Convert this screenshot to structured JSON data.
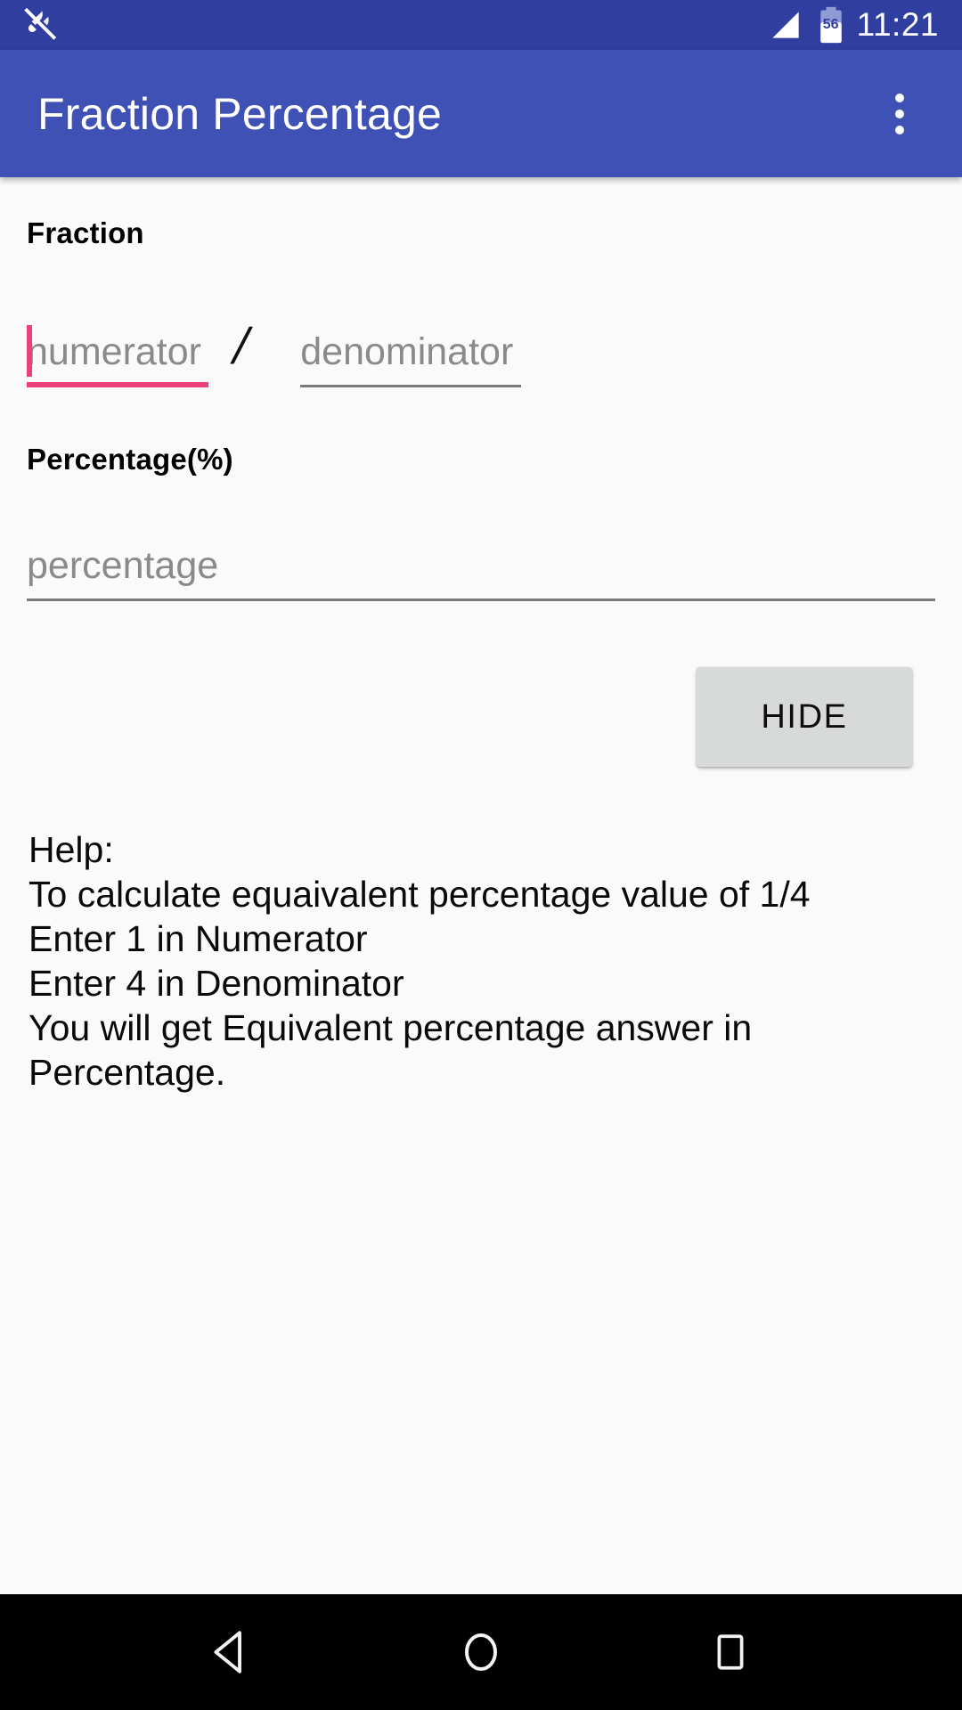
{
  "status_bar": {
    "notification_icon": "do-not-disturb-slash-icon",
    "signal_icon": "signal-triangle-icon",
    "battery_icon": "battery-icon",
    "battery_level": "56",
    "time": "11:21",
    "background_color": "#303f9f"
  },
  "app_bar": {
    "title": "Fraction Percentage",
    "overflow_icon": "overflow-menu-icon",
    "background_color": "#3f51b5",
    "text_color": "#ffffff"
  },
  "form": {
    "fraction_label": "Fraction",
    "numerator": {
      "placeholder": "numerator",
      "value": "",
      "focused": true,
      "accent_color": "#ec407a"
    },
    "separator": "/",
    "denominator": {
      "placeholder": "denominator",
      "value": "",
      "focused": false,
      "underline_color": "#777b7d"
    },
    "percentage_label": "Percentage(%)",
    "percentage": {
      "placeholder": "percentage",
      "value": "",
      "focused": false,
      "underline_color": "#777b7d"
    },
    "hide_button_label": "HIDE",
    "hide_button_color": "#d8d9d9"
  },
  "help": {
    "lines": [
      "Help:",
      "To calculate equaivalent percentage value of 1/4",
      "Enter 1 in Numerator",
      "Enter 4 in Denominator",
      "You will get Equivalent percentage answer in",
      "Percentage."
    ]
  },
  "nav_bar": {
    "back_icon": "back-triangle-icon",
    "home_icon": "home-circle-icon",
    "recents_icon": "recents-square-icon",
    "background_color": "#000000"
  }
}
